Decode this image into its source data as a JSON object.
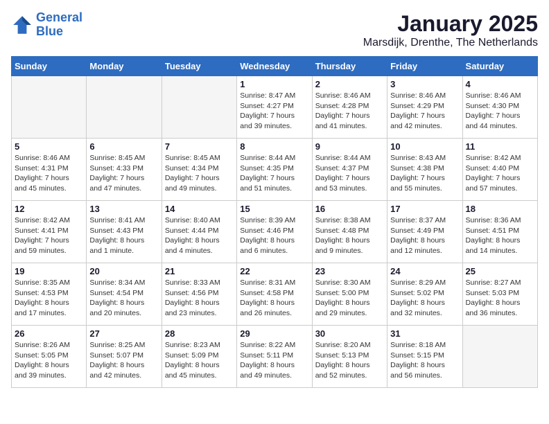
{
  "header": {
    "logo_line1": "General",
    "logo_line2": "Blue",
    "month": "January 2025",
    "location": "Marsdijk, Drenthe, The Netherlands"
  },
  "weekdays": [
    "Sunday",
    "Monday",
    "Tuesday",
    "Wednesday",
    "Thursday",
    "Friday",
    "Saturday"
  ],
  "weeks": [
    [
      {
        "day": "",
        "info": ""
      },
      {
        "day": "",
        "info": ""
      },
      {
        "day": "",
        "info": ""
      },
      {
        "day": "1",
        "info": "Sunrise: 8:47 AM\nSunset: 4:27 PM\nDaylight: 7 hours\nand 39 minutes."
      },
      {
        "day": "2",
        "info": "Sunrise: 8:46 AM\nSunset: 4:28 PM\nDaylight: 7 hours\nand 41 minutes."
      },
      {
        "day": "3",
        "info": "Sunrise: 8:46 AM\nSunset: 4:29 PM\nDaylight: 7 hours\nand 42 minutes."
      },
      {
        "day": "4",
        "info": "Sunrise: 8:46 AM\nSunset: 4:30 PM\nDaylight: 7 hours\nand 44 minutes."
      }
    ],
    [
      {
        "day": "5",
        "info": "Sunrise: 8:46 AM\nSunset: 4:31 PM\nDaylight: 7 hours\nand 45 minutes."
      },
      {
        "day": "6",
        "info": "Sunrise: 8:45 AM\nSunset: 4:33 PM\nDaylight: 7 hours\nand 47 minutes."
      },
      {
        "day": "7",
        "info": "Sunrise: 8:45 AM\nSunset: 4:34 PM\nDaylight: 7 hours\nand 49 minutes."
      },
      {
        "day": "8",
        "info": "Sunrise: 8:44 AM\nSunset: 4:35 PM\nDaylight: 7 hours\nand 51 minutes."
      },
      {
        "day": "9",
        "info": "Sunrise: 8:44 AM\nSunset: 4:37 PM\nDaylight: 7 hours\nand 53 minutes."
      },
      {
        "day": "10",
        "info": "Sunrise: 8:43 AM\nSunset: 4:38 PM\nDaylight: 7 hours\nand 55 minutes."
      },
      {
        "day": "11",
        "info": "Sunrise: 8:42 AM\nSunset: 4:40 PM\nDaylight: 7 hours\nand 57 minutes."
      }
    ],
    [
      {
        "day": "12",
        "info": "Sunrise: 8:42 AM\nSunset: 4:41 PM\nDaylight: 7 hours\nand 59 minutes."
      },
      {
        "day": "13",
        "info": "Sunrise: 8:41 AM\nSunset: 4:43 PM\nDaylight: 8 hours\nand 1 minute."
      },
      {
        "day": "14",
        "info": "Sunrise: 8:40 AM\nSunset: 4:44 PM\nDaylight: 8 hours\nand 4 minutes."
      },
      {
        "day": "15",
        "info": "Sunrise: 8:39 AM\nSunset: 4:46 PM\nDaylight: 8 hours\nand 6 minutes."
      },
      {
        "day": "16",
        "info": "Sunrise: 8:38 AM\nSunset: 4:48 PM\nDaylight: 8 hours\nand 9 minutes."
      },
      {
        "day": "17",
        "info": "Sunrise: 8:37 AM\nSunset: 4:49 PM\nDaylight: 8 hours\nand 12 minutes."
      },
      {
        "day": "18",
        "info": "Sunrise: 8:36 AM\nSunset: 4:51 PM\nDaylight: 8 hours\nand 14 minutes."
      }
    ],
    [
      {
        "day": "19",
        "info": "Sunrise: 8:35 AM\nSunset: 4:53 PM\nDaylight: 8 hours\nand 17 minutes."
      },
      {
        "day": "20",
        "info": "Sunrise: 8:34 AM\nSunset: 4:54 PM\nDaylight: 8 hours\nand 20 minutes."
      },
      {
        "day": "21",
        "info": "Sunrise: 8:33 AM\nSunset: 4:56 PM\nDaylight: 8 hours\nand 23 minutes."
      },
      {
        "day": "22",
        "info": "Sunrise: 8:31 AM\nSunset: 4:58 PM\nDaylight: 8 hours\nand 26 minutes."
      },
      {
        "day": "23",
        "info": "Sunrise: 8:30 AM\nSunset: 5:00 PM\nDaylight: 8 hours\nand 29 minutes."
      },
      {
        "day": "24",
        "info": "Sunrise: 8:29 AM\nSunset: 5:02 PM\nDaylight: 8 hours\nand 32 minutes."
      },
      {
        "day": "25",
        "info": "Sunrise: 8:27 AM\nSunset: 5:03 PM\nDaylight: 8 hours\nand 36 minutes."
      }
    ],
    [
      {
        "day": "26",
        "info": "Sunrise: 8:26 AM\nSunset: 5:05 PM\nDaylight: 8 hours\nand 39 minutes."
      },
      {
        "day": "27",
        "info": "Sunrise: 8:25 AM\nSunset: 5:07 PM\nDaylight: 8 hours\nand 42 minutes."
      },
      {
        "day": "28",
        "info": "Sunrise: 8:23 AM\nSunset: 5:09 PM\nDaylight: 8 hours\nand 45 minutes."
      },
      {
        "day": "29",
        "info": "Sunrise: 8:22 AM\nSunset: 5:11 PM\nDaylight: 8 hours\nand 49 minutes."
      },
      {
        "day": "30",
        "info": "Sunrise: 8:20 AM\nSunset: 5:13 PM\nDaylight: 8 hours\nand 52 minutes."
      },
      {
        "day": "31",
        "info": "Sunrise: 8:18 AM\nSunset: 5:15 PM\nDaylight: 8 hours\nand 56 minutes."
      },
      {
        "day": "",
        "info": ""
      }
    ]
  ]
}
